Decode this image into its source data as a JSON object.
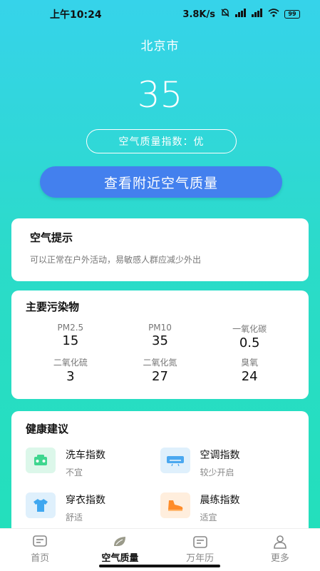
{
  "status_bar": {
    "time": "上午10:24",
    "speed": "3.8K/s",
    "battery": "99"
  },
  "header": {
    "city": "北京市",
    "aqi_value": "35",
    "aqi_label": "空气质量指数：优"
  },
  "nearby_button": "查看附近空气质量",
  "tip_card": {
    "title": "空气提示",
    "text": "可以正常在户外活动，易敏感人群应减少外出"
  },
  "pollutant_card": {
    "title": "主要污染物",
    "items": [
      {
        "name": "PM2.5",
        "value": "15"
      },
      {
        "name": "PM10",
        "value": "35"
      },
      {
        "name": "一氧化碳",
        "value": "0.5"
      },
      {
        "name": "二氧化硫",
        "value": "3"
      },
      {
        "name": "二氧化氮",
        "value": "27"
      },
      {
        "name": "臭氧",
        "value": "24"
      }
    ]
  },
  "health_card": {
    "title": "健康建议",
    "items": [
      {
        "name": "洗车指数",
        "desc": "不宜",
        "icon": "car-wash-icon",
        "color": "#3ed68f"
      },
      {
        "name": "空调指数",
        "desc": "较少开启",
        "icon": "air-conditioner-icon",
        "color": "#4aa8f0"
      },
      {
        "name": "穿衣指数",
        "desc": "舒适",
        "icon": "clothing-icon",
        "color": "#3fa7f0"
      },
      {
        "name": "晨练指数",
        "desc": "适宜",
        "icon": "sneaker-icon",
        "color": "#ff8c2a"
      }
    ]
  },
  "tabbar": {
    "tabs": [
      {
        "label": "首页",
        "icon": "home-icon"
      },
      {
        "label": "空气质量",
        "icon": "leaf-icon"
      },
      {
        "label": "万年历",
        "icon": "calendar-icon"
      },
      {
        "label": "更多",
        "icon": "user-icon"
      }
    ],
    "active": 1
  }
}
